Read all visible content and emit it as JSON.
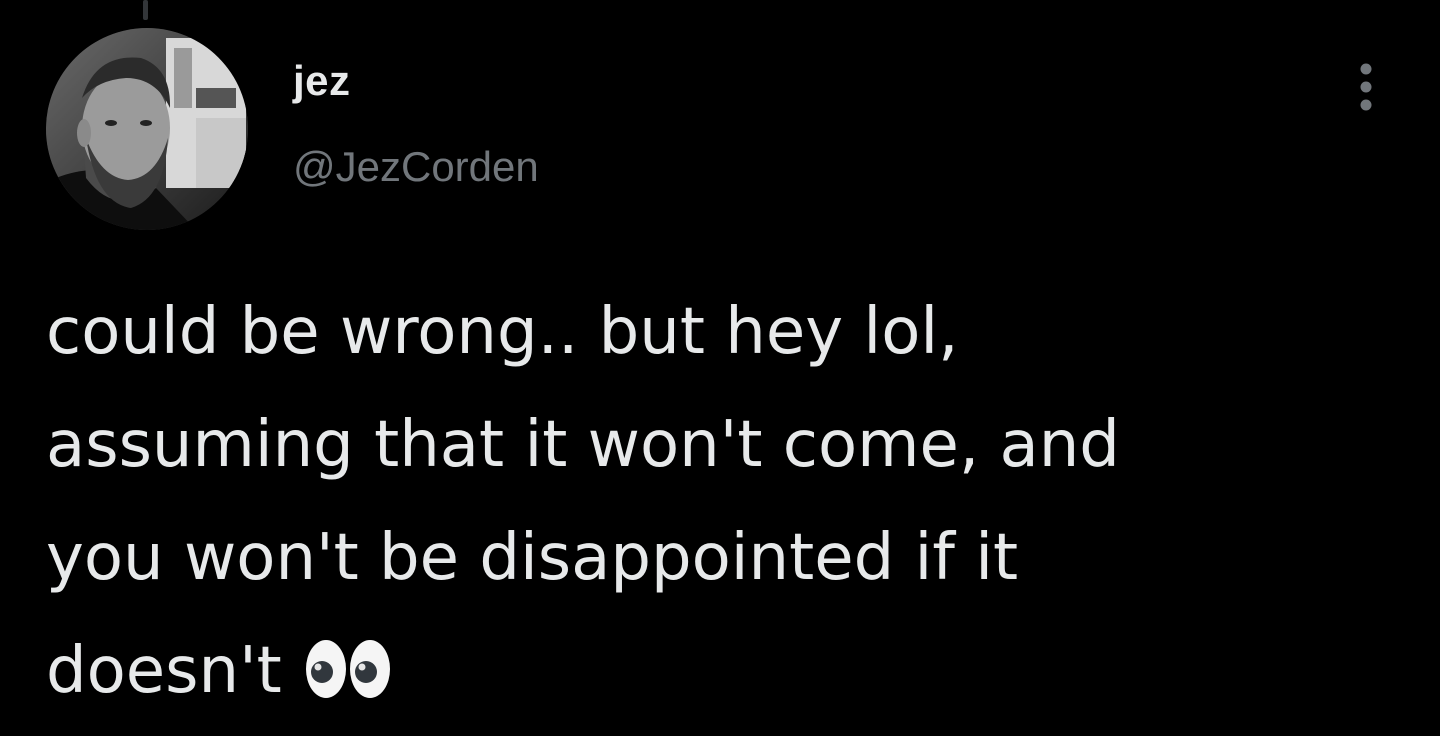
{
  "tweet": {
    "author": {
      "display_name": "jez",
      "handle": "@JezCorden",
      "avatar_icon": "profile-photo"
    },
    "text_lines": [
      "could be wrong.. but hey lol,",
      "assuming that it won't come, and",
      "you won't be disappointed if it",
      "doesn't"
    ],
    "emoji": "eyes-emoji",
    "more_icon": "more-vertical-icon"
  },
  "colors": {
    "background": "#000000",
    "primary_text": "#e7e9ea",
    "secondary_text": "#71767b"
  }
}
